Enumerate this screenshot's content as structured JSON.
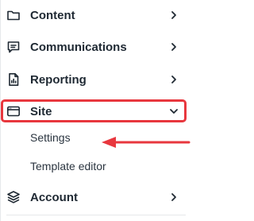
{
  "nav": {
    "items": [
      {
        "label": "Content",
        "icon": "folder-icon",
        "chevron": "chevron-right-icon"
      },
      {
        "label": "Communications",
        "icon": "message-icon",
        "chevron": "chevron-right-icon"
      },
      {
        "label": "Reporting",
        "icon": "report-icon",
        "chevron": "chevron-right-icon"
      },
      {
        "label": "Site",
        "icon": "browser-window-icon",
        "chevron": "chevron-down-icon",
        "expanded": true
      },
      {
        "label": "Account",
        "icon": "layers-icon",
        "chevron": "chevron-right-icon"
      }
    ],
    "site_subitems": [
      {
        "label": "Settings"
      },
      {
        "label": "Template editor"
      }
    ]
  },
  "annotation": {
    "highlight_color": "#e8373e",
    "arrow_color": "#e8373e"
  }
}
